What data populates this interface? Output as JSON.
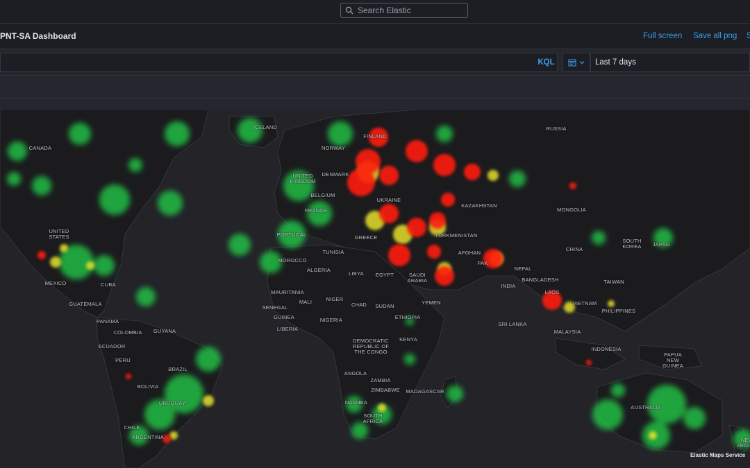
{
  "header": {
    "search_placeholder": "Search Elastic"
  },
  "dashboard": {
    "title": "PNT-SA Dashboard",
    "actions": [
      "Full screen",
      "Save all png",
      "S"
    ]
  },
  "query": {
    "language": "KQL",
    "time_range": "Last 7 days"
  },
  "map": {
    "attribution": "Elastic Maps Service",
    "country_labels": [
      "CANADA",
      "ICELAND",
      "NORWAY",
      "FINLAND",
      "RUSSIA",
      "UNITED KINGDOM",
      "DENMARK",
      "BELGIUM",
      "FRANCE",
      "UKRAINE",
      "KAZAKHSTAN",
      "MONGOLIA",
      "UNITED STATES",
      "PORTUGAL",
      "GREECE",
      "TURKMENISTAN",
      "MOROCCO",
      "TUNISIA",
      "AFGHAN",
      "CHINA",
      "SOUTH KOREA",
      "JAPAN",
      "ALGERIA",
      "LIBYA",
      "EGYPT",
      "SAUDI ARABIA",
      "PAK",
      "NEPAL",
      "MEXICO",
      "CUBA",
      "GUATEMALA",
      "MAURITANIA",
      "MALI",
      "NIGER",
      "CHAD",
      "SUDAN",
      "YEMEN",
      "INDIA",
      "BANGLADESH",
      "LAOS",
      "TAIWAN",
      "VIETNAM",
      "SENEGAL",
      "GUINEA",
      "LIBERIA",
      "NIGERIA",
      "ETHIOPIA",
      "SRI LANKA",
      "PHILIPPINES",
      "PANAMA",
      "COLOMBIA",
      "GUYANA",
      "ECUADOR",
      "PERU",
      "BRAZIL",
      "BOLIVIA",
      "DEMOCRATIC REPUBLIC OF THE CONGO",
      "KENYA",
      "MALAYSIA",
      "INDONESIA",
      "PAPUA NEW GUINEA",
      "ANGOLA",
      "ZAMBIA",
      "ZIMBABWE",
      "MADAGASCAR",
      "NAMIBIA",
      "SOUTH AFRICA",
      "CHILE",
      "ARGENTINA",
      "URUGUAY",
      "AUSTRALIA",
      "NEW ZEALAND"
    ],
    "legend_colors": {
      "green": "#22d24a",
      "yellow": "#e6e02a",
      "red": "#ff1a10"
    }
  }
}
